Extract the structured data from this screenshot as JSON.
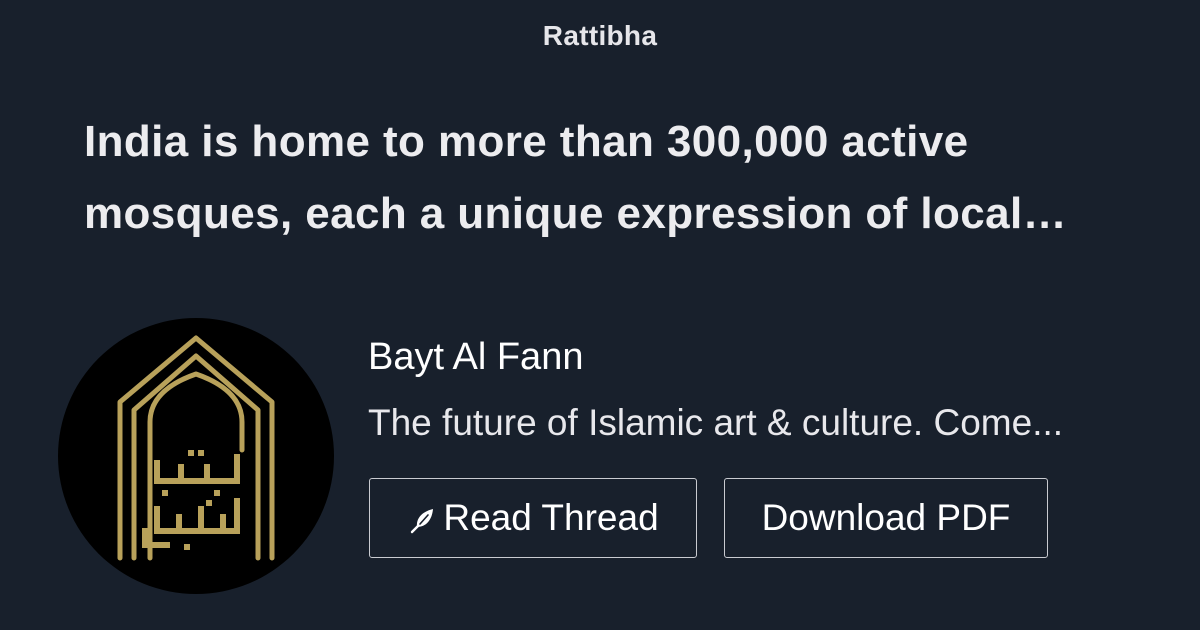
{
  "brand": {
    "name": "Rattibha"
  },
  "thread": {
    "title": "India is home to more than 300,000 active mosques, each a unique expression of local…"
  },
  "author": {
    "name": "Bayt Al Fann",
    "bio": "The future of Islamic art & culture. Come...",
    "avatar_icon": "arch-calligraphy-logo",
    "logo_text": "بيت الفن",
    "avatar_colors": {
      "background": "#000000",
      "gold": "#b8a15a"
    }
  },
  "actions": {
    "read_thread_label": "Read Thread",
    "read_thread_icon": "feather-icon",
    "download_pdf_label": "Download PDF"
  },
  "colors": {
    "background": "#18202c",
    "text": "#ececef",
    "button_border": "#c9cbd1"
  }
}
